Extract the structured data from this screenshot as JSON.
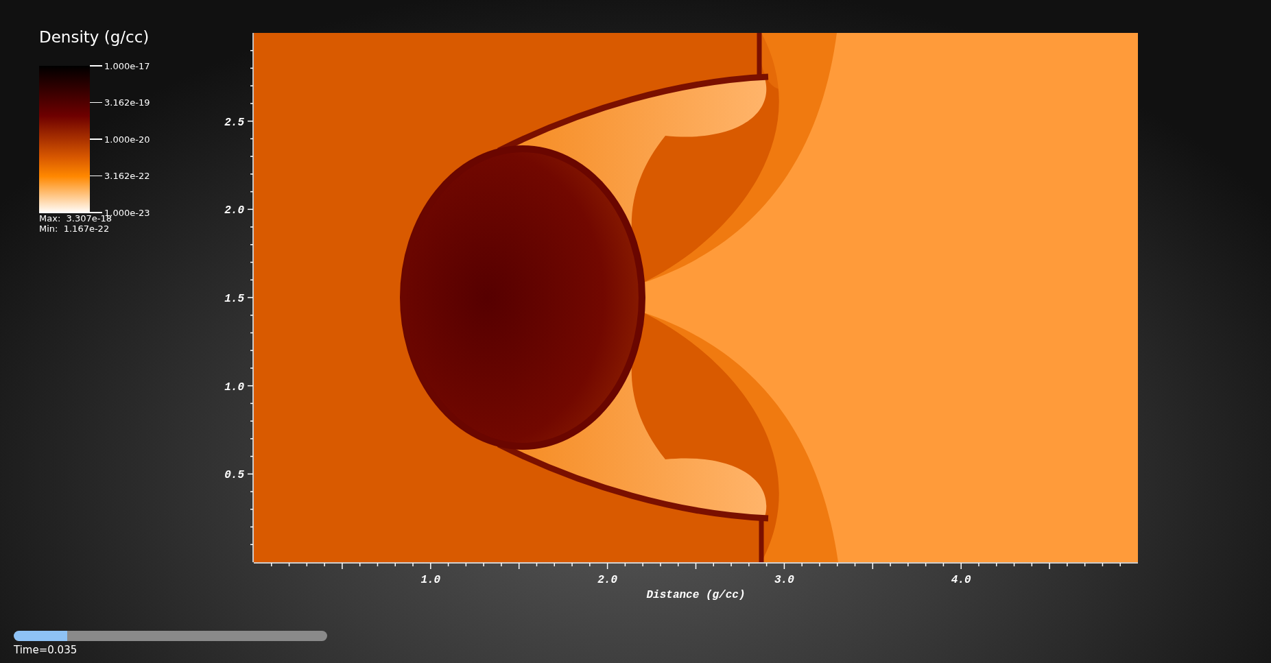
{
  "legend": {
    "title": "Density (g/cc)",
    "ticks": [
      "1.000e-17",
      "3.162e-19",
      "1.000e-20",
      "3.162e-22",
      "1.000e-23"
    ],
    "max": "Max:  3.307e-18",
    "min": "Min:  1.167e-22"
  },
  "plot": {
    "x_ticks": [
      "1.0",
      "2.0",
      "3.0",
      "4.0"
    ],
    "y_ticks": [
      "2.5",
      "2.0",
      "1.5",
      "1.0",
      "0.5"
    ],
    "xlabel": "Distance (g/cc)"
  },
  "time_slider": {
    "level": 0.17,
    "label": "Time=0.035"
  }
}
